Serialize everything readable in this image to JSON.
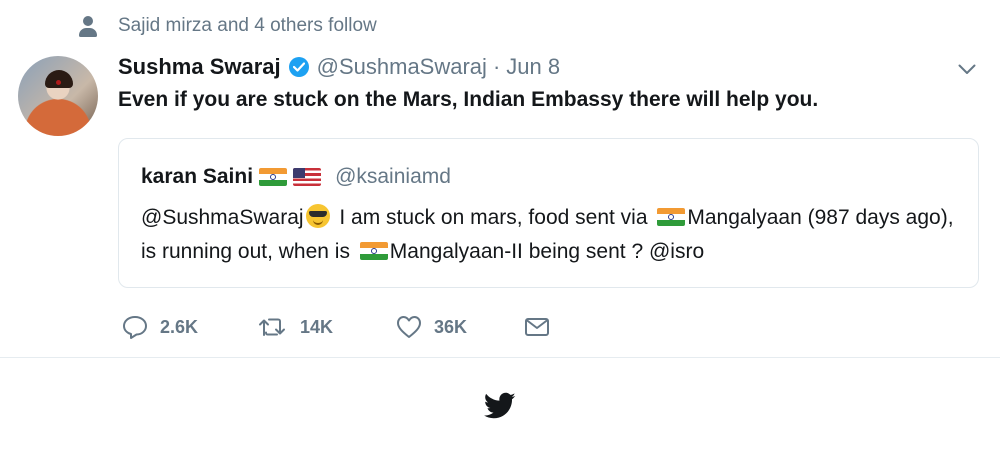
{
  "social_context": {
    "text": "Sajid mirza and 4 others follow",
    "icon": "person-icon"
  },
  "tweet": {
    "author_name": "Sushma Swaraj",
    "author_handle": "@SushmaSwaraj",
    "separator": "·",
    "date": "Jun 8",
    "text": "Even if you are stuck on the Mars, Indian Embassy there will help you."
  },
  "quoted_tweet": {
    "author_name": "karan Saini",
    "author_handle": "@ksainiamd",
    "text_part1": "@SushmaSwaraj",
    "text_part2": " I am stuck on mars, food sent via ",
    "text_part3": "Mangalyaan (987 days ago), is running out, when is ",
    "text_part4": "Mangalyaan-II being sent ? @isro"
  },
  "actions": {
    "replies": "2.6K",
    "retweets": "14K",
    "likes": "36K"
  },
  "colors": {
    "verified": "#1da1f2",
    "muted": "#657786",
    "border": "#e1e8ed",
    "text": "#14171a"
  }
}
